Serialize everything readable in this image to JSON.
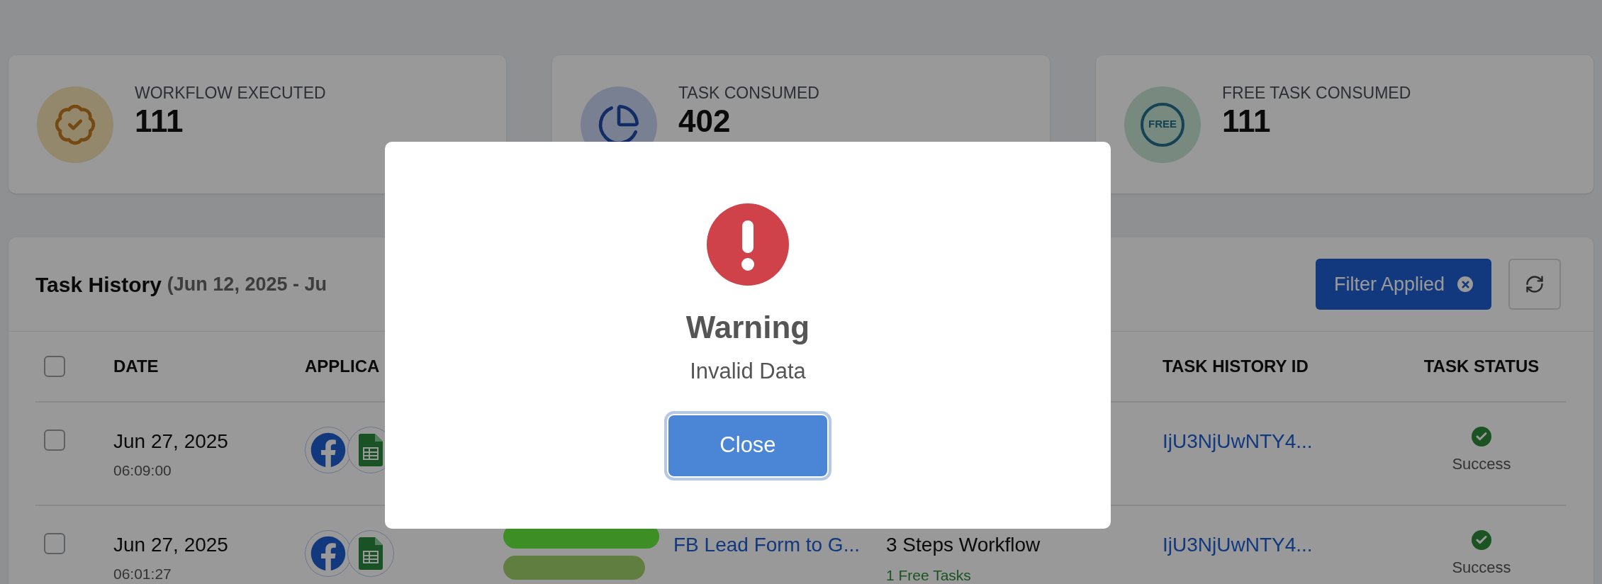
{
  "stats": [
    {
      "kind": "badge",
      "label": "WORKFLOW EXECUTED",
      "value": "111"
    },
    {
      "kind": "pie",
      "label": "TASK CONSUMED",
      "value": "402"
    },
    {
      "kind": "free",
      "label": "FREE TASK CONSUMED",
      "value": "111",
      "icon_text": "FREE"
    }
  ],
  "task_history": {
    "title": "Task History",
    "range": "(Jun 12, 2025 - Ju",
    "filter_button": "Filter Applied",
    "select_all": {
      "checked": false
    },
    "columns": [
      "DATE",
      "APPLICA",
      "",
      "",
      "TASK HISTORY ID",
      "TASK STATUS"
    ],
    "rows": [
      {
        "checked": false,
        "date": "Jun 27, 2025",
        "time": "06:09:00",
        "apps": [
          {
            "kind": "facebook"
          },
          {
            "kind": "sheets"
          }
        ],
        "id": "IjU3NjUwNTY4...",
        "status": "Success"
      },
      {
        "checked": false,
        "date": "Jun 27, 2025",
        "time": "06:01:27",
        "apps": [
          {
            "kind": "facebook"
          },
          {
            "kind": "sheets"
          }
        ],
        "workflow": "FB Lead Form to G...",
        "redacted": true,
        "steps": "3 Steps Workflow",
        "free_tasks": "1 Free Tasks",
        "id": "IjU3NjUwNTY4...",
        "status": "Success"
      }
    ]
  },
  "dialog": {
    "title": "Warning",
    "message": "Invalid Data",
    "button": "Close"
  }
}
